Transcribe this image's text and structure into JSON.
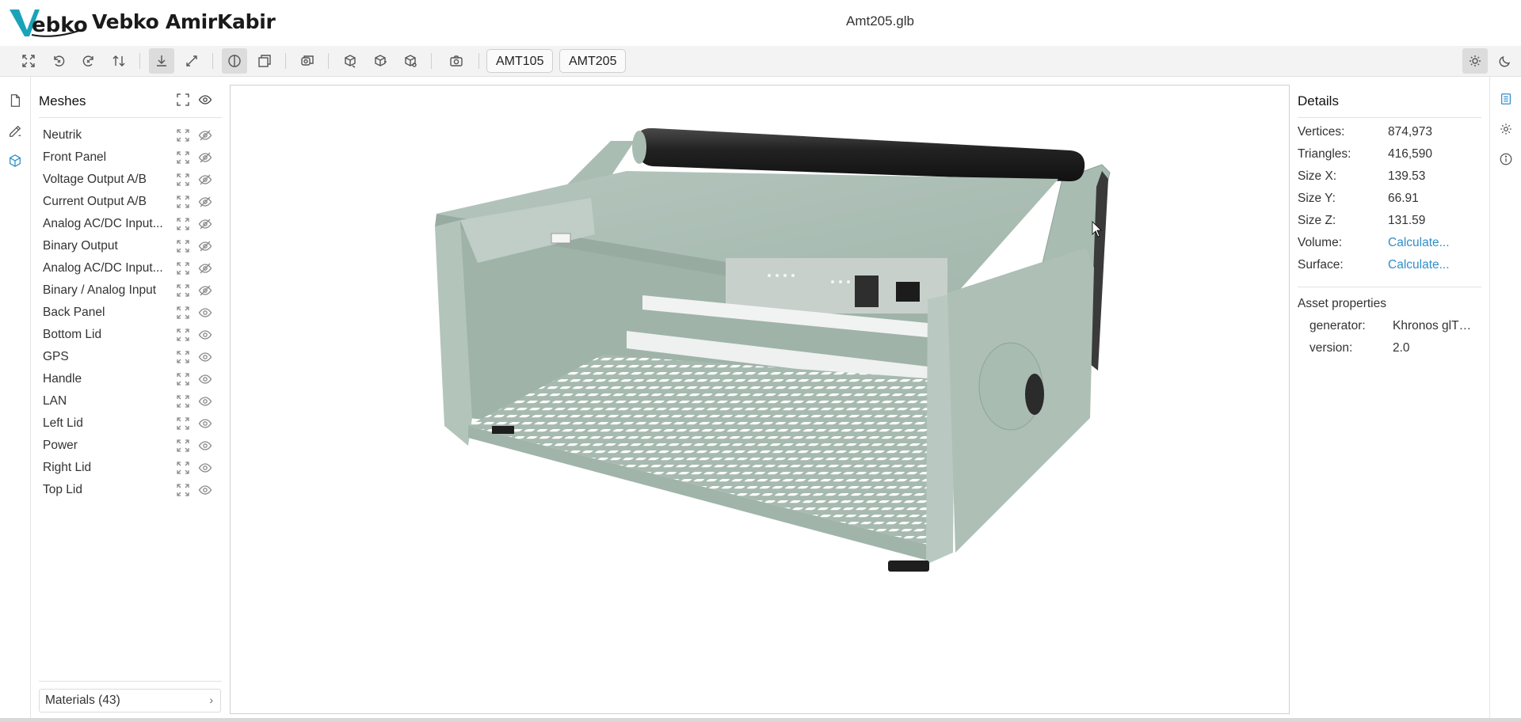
{
  "app": {
    "brand_name": "Vebko AmirKabir",
    "logo_text": "Vebko",
    "file_name": "Amt205.glb"
  },
  "toolbar": {
    "model_buttons": [
      "AMT105",
      "AMT205"
    ],
    "icons": [
      "fit-all-icon",
      "rotate-left-icon",
      "rotate-right-icon",
      "flip-up-icon",
      "fly-navigation-icon",
      "orbit-navigation-icon",
      "shading-icon",
      "edges-icon",
      "projection-icon",
      "view-front-icon",
      "view-top-icon",
      "view-side-icon",
      "snapshot-icon",
      "light-mode-icon",
      "dark-mode-icon"
    ]
  },
  "meshes": {
    "title": "Meshes",
    "items": [
      {
        "label": "Neutrik",
        "visible": false
      },
      {
        "label": "Front Panel",
        "visible": false
      },
      {
        "label": "Voltage Output A/B",
        "visible": false
      },
      {
        "label": "Current Output A/B",
        "visible": false
      },
      {
        "label": "Analog AC/DC Input...",
        "visible": false
      },
      {
        "label": "Binary Output",
        "visible": false
      },
      {
        "label": "Analog AC/DC Input...",
        "visible": false
      },
      {
        "label": "Binary / Analog Input",
        "visible": false
      },
      {
        "label": "Back Panel",
        "visible": true
      },
      {
        "label": "Bottom Lid",
        "visible": true
      },
      {
        "label": "GPS",
        "visible": true
      },
      {
        "label": "Handle",
        "visible": true
      },
      {
        "label": "LAN",
        "visible": true
      },
      {
        "label": "Left Lid",
        "visible": true
      },
      {
        "label": "Power",
        "visible": true
      },
      {
        "label": "Right Lid",
        "visible": true
      },
      {
        "label": "Top Lid",
        "visible": true
      }
    ],
    "materials_label": "Materials (43)"
  },
  "details": {
    "title": "Details",
    "rows": [
      {
        "key": "Vertices:",
        "value": "874,973"
      },
      {
        "key": "Triangles:",
        "value": "416,590"
      },
      {
        "key": "Size X:",
        "value": "139.53"
      },
      {
        "key": "Size Y:",
        "value": "66.91"
      },
      {
        "key": "Size Z:",
        "value": "131.59"
      },
      {
        "key": "Volume:",
        "value": "Calculate..."
      },
      {
        "key": "Surface:",
        "value": "Calculate..."
      }
    ],
    "asset_title": "Asset properties",
    "asset_rows": [
      {
        "key": "generator:",
        "value": "Khronos glTF Blender I/O"
      },
      {
        "key": "version:",
        "value": "2.0"
      }
    ]
  },
  "colors": {
    "accent": "#2f8fc9",
    "model_body": "#a9bcb2",
    "model_handle": "#2b2b2b"
  }
}
